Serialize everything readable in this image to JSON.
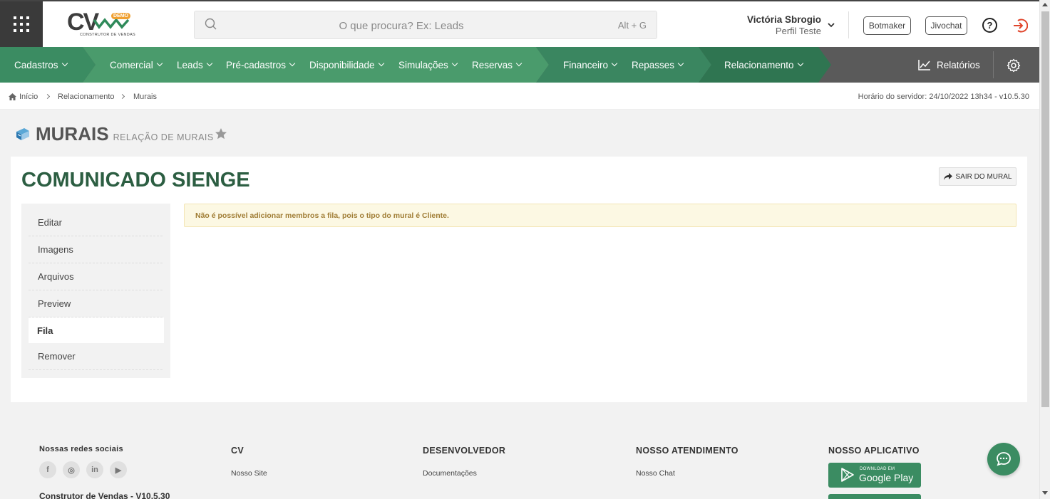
{
  "header": {
    "logo_text": "CV",
    "logo_badge": "DEMO",
    "logo_subtitle": "CONSTRUTOR DE VENDAS",
    "search_placeholder": "O que procura? Ex: Leads",
    "search_shortcut": "Alt + G",
    "user_name": "Victória Sbrogio",
    "user_profile": "Perfil Teste",
    "botmaker_label": "Botmaker",
    "jivochat_label": "Jivochat",
    "help_label": "?"
  },
  "nav": {
    "items": [
      {
        "label": "Cadastros"
      },
      {
        "label": "Comercial"
      },
      {
        "label": "Leads"
      },
      {
        "label": "Pré-cadastros"
      },
      {
        "label": "Disponibilidade"
      },
      {
        "label": "Simulações"
      },
      {
        "label": "Reservas"
      },
      {
        "label": "Financeiro"
      },
      {
        "label": "Repasses"
      },
      {
        "label": "Relacionamento"
      }
    ],
    "reports_label": "Relatórios",
    "colors": {
      "seg1": "#3b8c62",
      "seg2": "#4a9b6c",
      "seg3": "#3a8660",
      "seg4": "#2f7551",
      "rest": "#5a5a5a"
    }
  },
  "breadcrumb": {
    "items": [
      "Início",
      "Relacionamento",
      "Murais"
    ],
    "server_time": "Horário do servidor: 24/10/2022 13h34 - v10.5.30"
  },
  "page": {
    "title": "MURAIS",
    "subtitle": "RELAÇÃO DE MURAIS"
  },
  "card": {
    "title": "COMUNICADO SIENGE",
    "exit_label": "SAIR DO MURAL",
    "menu": [
      "Editar",
      "Imagens",
      "Arquivos",
      "Preview",
      "Fila",
      "Remover"
    ],
    "active_menu": "Fila",
    "alert": "Não é possível adicionar membros a fila, pois o tipo do mural é Cliente."
  },
  "footer": {
    "social_title": "Nossas redes sociais",
    "social": [
      "f",
      "◎",
      "in",
      "▶"
    ],
    "cv_title": "CV",
    "cv_link": "Nosso Site",
    "dev_title": "DESENVOLVEDOR",
    "dev_link": "Documentações",
    "support_title": "NOSSO ATENDIMENTO",
    "support_link": "Nosso Chat",
    "app_title": "NOSSO APLICATIVO",
    "gplay_small": "DOWNLOAD EM",
    "gplay_big": "Google Play",
    "version_cut": "Construtor de Vendas - V10.5.30"
  }
}
